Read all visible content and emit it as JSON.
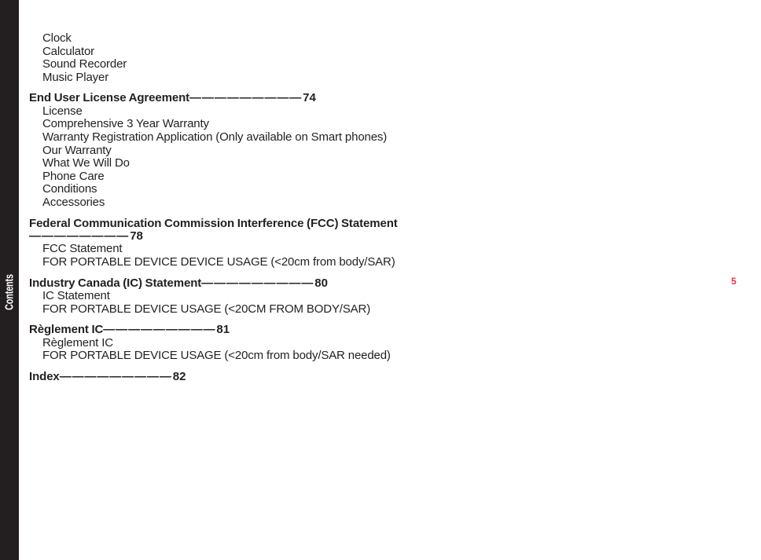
{
  "side_tab": {
    "label": "Contents"
  },
  "page_number": "5",
  "colors": {
    "tab_background": "#231f20",
    "tab_text": "#ffffff",
    "body_text": "#231f20",
    "page_number": "#e8334a"
  },
  "toc": {
    "groups": [
      {
        "heading": null,
        "items": [
          "Clock",
          "Calculator",
          "Sound Recorder",
          "Music Player"
        ]
      },
      {
        "heading": {
          "title": "End User License Agreement",
          "leader": "—————————",
          "page": "74"
        },
        "items": [
          "License",
          "Comprehensive 3 Year Warranty",
          "Warranty Registration Application (Only available on Smart phones)",
          "Our Warranty",
          "What We Will Do",
          "Phone Care",
          "Conditions",
          "Accessories"
        ]
      },
      {
        "heading": {
          "title": "Federal Communication Commission Interference (FCC) Statement",
          "leader": "————————",
          "page": "78"
        },
        "items": [
          "FCC Statement",
          "FOR PORTABLE DEVICE DEVICE USAGE (<20cm from body/SAR)"
        ]
      },
      {
        "heading": {
          "title": "Industry Canada (IC) Statement",
          "leader": "—————————",
          "page": "80"
        },
        "items": [
          "IC Statement",
          "FOR PORTABLE DEVICE USAGE (<20CM FROM BODY/SAR)"
        ]
      },
      {
        "heading": {
          "title": "Règlement IC",
          "leader": "—————————",
          "page": "81"
        },
        "items": [
          "Règlement IC",
          "FOR PORTABLE DEVICE USAGE (<20cm from body/SAR needed)"
        ]
      },
      {
        "heading": {
          "title": "Index",
          "leader": "—————————",
          "page": "82"
        },
        "items": []
      }
    ]
  }
}
